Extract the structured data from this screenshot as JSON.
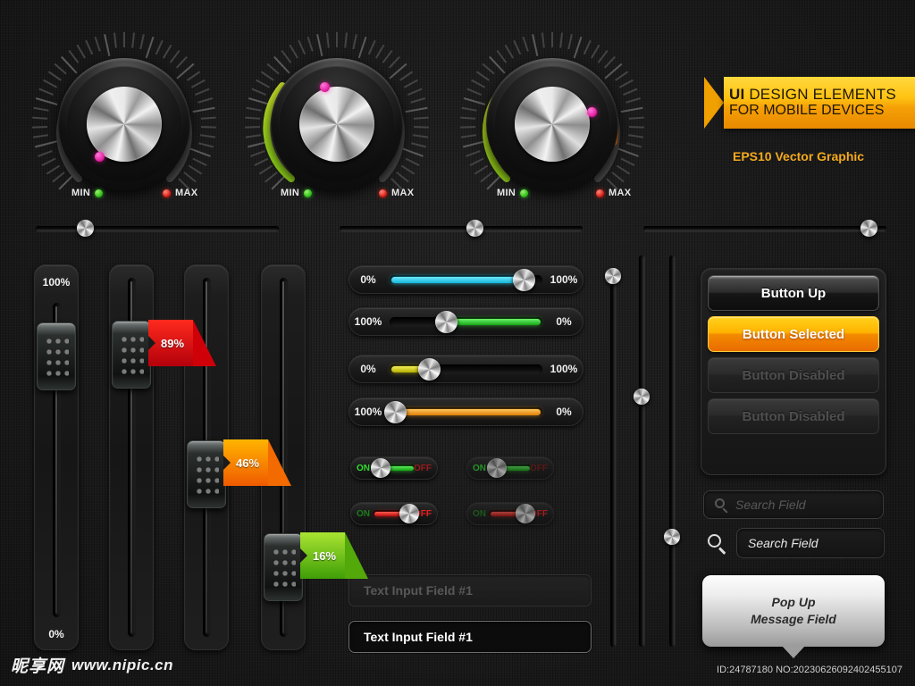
{
  "banner": {
    "line1_bold": "UI",
    "line1_rest": " DESIGN ELEMENTS",
    "line2": "FOR MOBILE DEVICES",
    "subtitle": "EPS10 Vector Graphic",
    "accent_color": "#ffc313"
  },
  "knobs": [
    {
      "id": "knob-1",
      "min_label": "MIN",
      "max_label": "MAX",
      "arc_percent": 0,
      "pointer_deg": 205,
      "arc_style": "none"
    },
    {
      "id": "knob-2",
      "min_label": "MIN",
      "max_label": "MAX",
      "arc_percent": 22,
      "pointer_deg": 340,
      "arc_style": "green"
    },
    {
      "id": "knob-3",
      "min_label": "MIN",
      "max_label": "MAX",
      "arc_percent": 80,
      "pointer_deg": 72,
      "arc_style": "green-yellow-red"
    }
  ],
  "top_rails": [
    {
      "id": "rail-1",
      "value_percent": 20
    },
    {
      "id": "rail-2",
      "value_percent": 50
    },
    {
      "id": "rail-3",
      "value_percent": 98
    }
  ],
  "faders": [
    {
      "id": "fader-1",
      "top_label": "100%",
      "bottom_label": "0%",
      "value_percent": 100,
      "flag": null
    },
    {
      "id": "fader-2",
      "value_percent": 89,
      "flag": {
        "text": "89%",
        "color": "red"
      }
    },
    {
      "id": "fader-3",
      "value_percent": 46,
      "flag": {
        "text": "46%",
        "color": "orange"
      }
    },
    {
      "id": "fader-4",
      "value_percent": 16,
      "flag": {
        "text": "16%",
        "color": "green"
      }
    }
  ],
  "h_sliders": [
    {
      "id": "slider-cyan",
      "left_label": "0%",
      "right_label": "100%",
      "value_percent": 88,
      "fill_color": "#24c8e8",
      "fill_from": "left"
    },
    {
      "id": "slider-green",
      "left_label": "100%",
      "right_label": "0%",
      "value_percent": 37,
      "fill_color": "#2fd02f",
      "fill_from": "right"
    },
    {
      "id": "slider-yellow",
      "left_label": "0%",
      "right_label": "100%",
      "value_percent": 26,
      "fill_color": "#d7d300",
      "fill_from": "left"
    },
    {
      "id": "slider-orange",
      "left_label": "100%",
      "right_label": "0%",
      "value_percent": 4,
      "fill_color": "#f39a12",
      "fill_from": "right"
    }
  ],
  "toggles": [
    {
      "id": "toggle-1",
      "on_label": "ON",
      "off_label": "OFF",
      "state": "on",
      "enabled": true,
      "bar_color": "#22c322",
      "knob_percent": 34
    },
    {
      "id": "toggle-2",
      "on_label": "ON",
      "off_label": "OFF",
      "state": "on",
      "enabled": false,
      "bar_color": "#22c322",
      "knob_percent": 34
    },
    {
      "id": "toggle-3",
      "on_label": "ON",
      "off_label": "OFF",
      "state": "off",
      "enabled": true,
      "bar_color": "#d81414",
      "knob_percent": 68
    },
    {
      "id": "toggle-4",
      "on_label": "ON",
      "off_label": "OFF",
      "state": "off",
      "enabled": false,
      "bar_color": "#d81414",
      "knob_percent": 68
    }
  ],
  "text_inputs": [
    {
      "id": "text-input-inactive",
      "value": "Text Input Field #1",
      "state": "inactive"
    },
    {
      "id": "text-input-active",
      "value": "Text Input Field #1",
      "state": "active"
    }
  ],
  "v_rails": [
    {
      "id": "v-rail-1",
      "value_percent": 6
    },
    {
      "id": "v-rail-2",
      "value_percent": 37
    },
    {
      "id": "v-rail-3",
      "value_percent": 72
    }
  ],
  "buttons": [
    {
      "id": "button-up",
      "label": "Button Up",
      "state": "up"
    },
    {
      "id": "button-selected",
      "label": "Button Selected",
      "state": "selected"
    },
    {
      "id": "button-disabled-1",
      "label": "Button Disabled",
      "state": "disabled"
    },
    {
      "id": "button-disabled-2",
      "label": "Button Disabled",
      "state": "disabled"
    }
  ],
  "search_fields": [
    {
      "id": "search-field-inline",
      "placeholder": "Search Field",
      "icon": "search-icon",
      "icon_inside": true
    },
    {
      "id": "search-field-external",
      "placeholder": "Search Field",
      "icon": "search-icon",
      "icon_inside": false
    }
  ],
  "popup": {
    "line1": "Pop Up",
    "line2": "Message Field"
  },
  "footer": {
    "watermark_cjk": "昵享网",
    "watermark_site": "www.nipic.cn",
    "id_text": "ID:24787180 NO:20230626092402455107"
  }
}
